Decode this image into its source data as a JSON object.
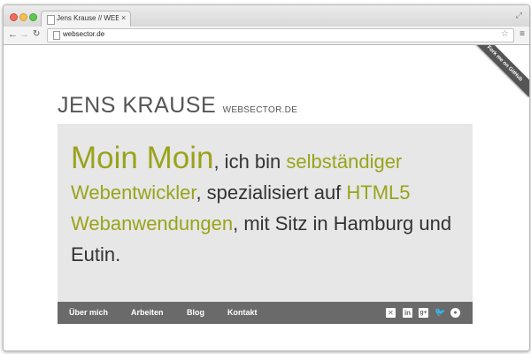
{
  "browser": {
    "tab_title": "Jens Krause // WEBSECTOR",
    "tab_close": "×",
    "url": "websector.de",
    "icons": {
      "back": "back-arrow-icon",
      "forward": "forward-arrow-icon",
      "reload": "reload-icon",
      "star": "star-icon",
      "menu": "hamburger-menu-icon",
      "fullscreen": "expand-icon"
    }
  },
  "ribbon": {
    "label": "Fork me on GitHub"
  },
  "header": {
    "name": "JENS KRAUSE",
    "domain": "WEBSECTOR.DE"
  },
  "hero": {
    "greeting": "Moin Moin",
    "t1": ", ich bin ",
    "h1": "selbständiger Webentwickler",
    "t2": ", spezialisiert auf ",
    "h2": "HTML5 Webanwendungen",
    "t3": ", mit Sitz in Hamburg und Eutin."
  },
  "nav": {
    "items": [
      "Über mich",
      "Arbeiten",
      "Blog",
      "Kontakt"
    ]
  },
  "social": {
    "icons": [
      "xing-icon",
      "linkedin-icon",
      "google-plus-icon",
      "twitter-icon",
      "github-icon"
    ]
  },
  "colors": {
    "accent": "#9aa31a",
    "hero_bg": "#e7e7e7",
    "nav_bg": "#6a6a6a",
    "text": "#333333"
  }
}
